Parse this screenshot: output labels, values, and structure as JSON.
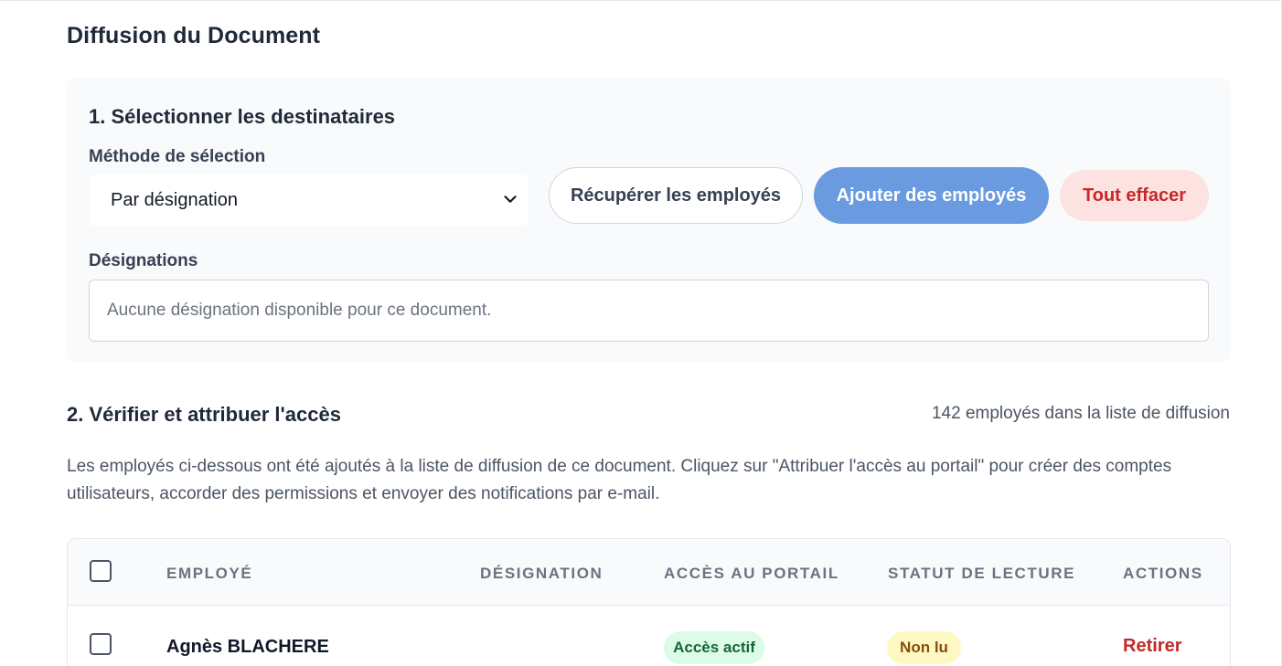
{
  "page": {
    "title": "Diffusion du Document"
  },
  "step1": {
    "title": "1. Sélectionner les destinataires",
    "method_label": "Méthode de sélection",
    "method_selected": "Par désignation",
    "buttons": {
      "fetch": "Récupérer les employés",
      "add": "Ajouter des employés",
      "clear": "Tout effacer"
    },
    "designations_label": "Désignations",
    "designations_empty": "Aucune désignation disponible pour ce document."
  },
  "step2": {
    "title": "2. Vérifier et attribuer l'accès",
    "count_text": "142 employés dans la liste de diffusion",
    "description": "Les employés ci-dessous ont été ajoutés à la liste de diffusion de ce document. Cliquez sur \"Attribuer l'accès au portail\" pour créer des comptes utilisateurs, accorder des permissions et envoyer des notifications par e-mail."
  },
  "table": {
    "headers": {
      "employee": "Employé",
      "designation": "Désignation",
      "portal_access": "Accès au portail",
      "read_status": "Statut de lecture",
      "actions": "Actions"
    },
    "rows": [
      {
        "name": "Agnès BLACHERE",
        "designation": "",
        "portal_access": "Accès actif",
        "read_status": "Non lu",
        "action": "Retirer"
      }
    ]
  },
  "colors": {
    "primary_button": "#6a9be0",
    "danger_text": "#c62828",
    "danger_bg": "#fde2e2",
    "active_badge_bg": "#dcfce7",
    "unread_badge_bg": "#fef9c3"
  }
}
